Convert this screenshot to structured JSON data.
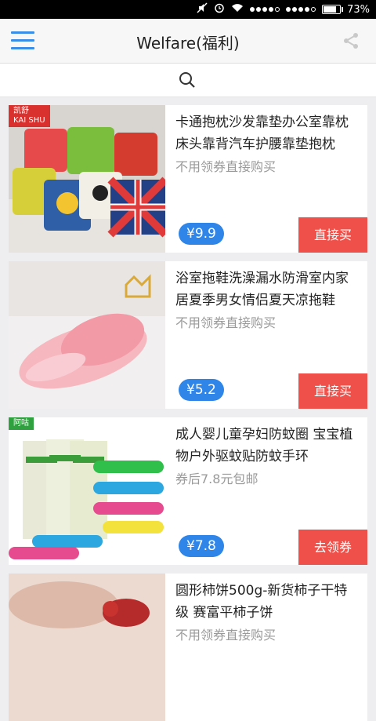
{
  "status_bar": {
    "battery": "73%"
  },
  "app_bar": {
    "title": "Welfare(福利)"
  },
  "products": [
    {
      "title": "卡通抱枕沙发靠垫办公室靠枕床头靠背汽车护腰靠垫抱枕",
      "subtitle": "不用领券直接购买",
      "price": "¥9.9",
      "action": "直接买",
      "brand_line1": "凯舒",
      "brand_line2": "KAI SHU"
    },
    {
      "title": "浴室拖鞋洗澡漏水防滑室内家居夏季男女情侣夏天凉拖鞋",
      "subtitle": "不用领券直接购买",
      "price": "¥5.2",
      "action": "直接买"
    },
    {
      "title": "成人婴儿童孕妇防蚊圈 宝宝植物户外驱蚊贴防蚊手环",
      "subtitle": "券后7.8元包邮",
      "price": "¥7.8",
      "action": "去领券",
      "brand_line1": "阿咕"
    },
    {
      "title": "圆形柿饼500g-新货柿子干特级 赛富平柿子饼",
      "subtitle": "不用领券直接购买",
      "price": "",
      "action": ""
    }
  ]
}
